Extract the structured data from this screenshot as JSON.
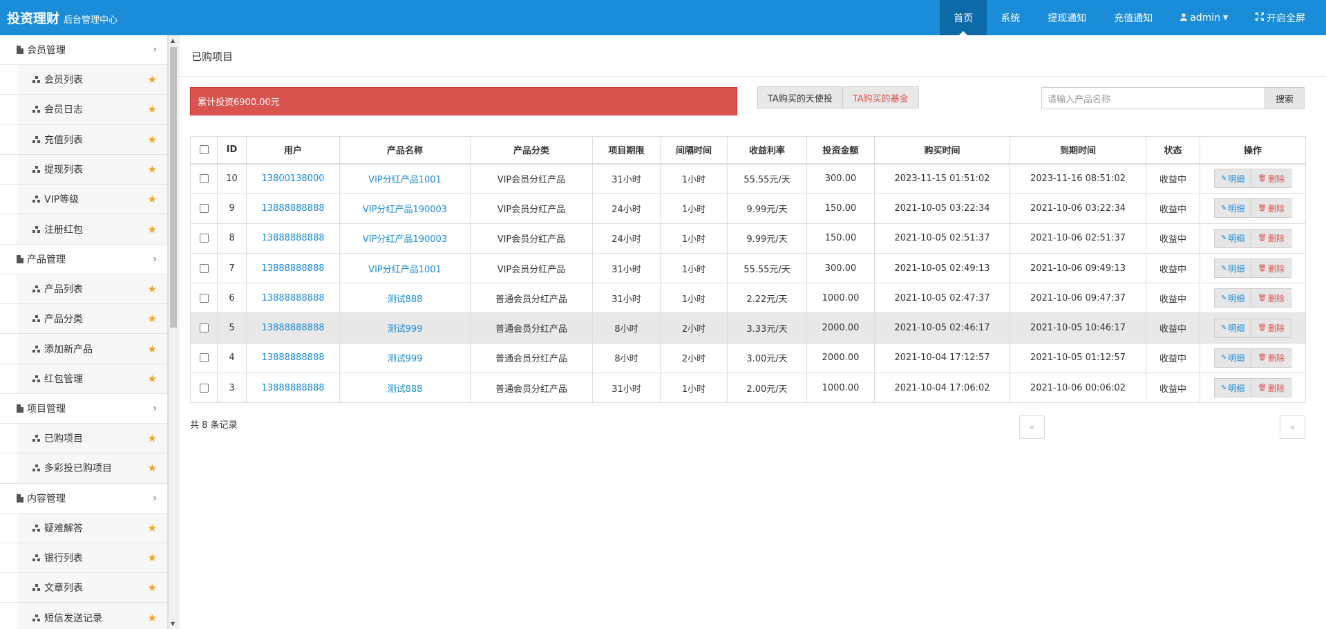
{
  "brand": {
    "title": "投资理财",
    "subtitle": "后台管理中心"
  },
  "topnav": [
    {
      "label": "首页",
      "active": true
    },
    {
      "label": "系统"
    },
    {
      "label": "提现通知"
    },
    {
      "label": "充值通知"
    },
    {
      "label": "admin",
      "icon": "user-icon",
      "dropdown": true
    },
    {
      "label": "开启全屏",
      "icon": "fullscreen-icon"
    }
  ],
  "sidebar": {
    "groups": [
      {
        "label": "会员管理",
        "items": [
          "会员列表",
          "会员日志",
          "充值列表",
          "提现列表",
          "VIP等级",
          "注册红包"
        ]
      },
      {
        "label": "产品管理",
        "items": [
          "产品列表",
          "产品分类",
          "添加新产品",
          "红包管理"
        ]
      },
      {
        "label": "项目管理",
        "items": [
          "已购项目",
          "多彩投已购项目"
        ]
      },
      {
        "label": "内容管理",
        "items": [
          "疑难解答",
          "银行列表",
          "文章列表",
          "短信发送记录"
        ]
      }
    ]
  },
  "page": {
    "title": "已购项目",
    "total_invest": "累计投资6900.00元",
    "tab_angel": "TA购买的天使投",
    "tab_fund": "TA购买的基金",
    "search_placeholder": "请输入产品名称",
    "search_button": "搜索",
    "record_count": "共 8 条记录",
    "pager_prev": "«",
    "pager_next": "»"
  },
  "table": {
    "headers": [
      "ID",
      "用户",
      "产品名称",
      "产品分类",
      "项目期限",
      "间隔时间",
      "收益利率",
      "投资金额",
      "购买时间",
      "到期时间",
      "状态",
      "操作"
    ],
    "detail_label": "明细",
    "delete_label": "删除",
    "rows": [
      {
        "id": "10",
        "user": "13800138000",
        "product": "VIP分红产品1001",
        "category": "VIP会员分红产品",
        "term": "31小时",
        "interval": "1小时",
        "rate": "55.55元/天",
        "amount": "300.00",
        "buy": "2023-11-15 01:51:02",
        "expire": "2023-11-16 08:51:02",
        "status": "收益中"
      },
      {
        "id": "9",
        "user": "13888888888",
        "product": "VIP分红产品190003",
        "category": "VIP会员分红产品",
        "term": "24小时",
        "interval": "1小时",
        "rate": "9.99元/天",
        "amount": "150.00",
        "buy": "2021-10-05 03:22:34",
        "expire": "2021-10-06 03:22:34",
        "status": "收益中"
      },
      {
        "id": "8",
        "user": "13888888888",
        "product": "VIP分红产品190003",
        "category": "VIP会员分红产品",
        "term": "24小时",
        "interval": "1小时",
        "rate": "9.99元/天",
        "amount": "150.00",
        "buy": "2021-10-05 02:51:37",
        "expire": "2021-10-06 02:51:37",
        "status": "收益中"
      },
      {
        "id": "7",
        "user": "13888888888",
        "product": "VIP分红产品1001",
        "category": "VIP会员分红产品",
        "term": "31小时",
        "interval": "1小时",
        "rate": "55.55元/天",
        "amount": "300.00",
        "buy": "2021-10-05 02:49:13",
        "expire": "2021-10-06 09:49:13",
        "status": "收益中"
      },
      {
        "id": "6",
        "user": "13888888888",
        "product": "测试888",
        "category": "普通会员分红产品",
        "term": "31小时",
        "interval": "1小时",
        "rate": "2.22元/天",
        "amount": "1000.00",
        "buy": "2021-10-05 02:47:37",
        "expire": "2021-10-06 09:47:37",
        "status": "收益中"
      },
      {
        "id": "5",
        "user": "13888888888",
        "product": "测试999",
        "category": "普通会员分红产品",
        "term": "8小时",
        "interval": "2小时",
        "rate": "3.33元/天",
        "amount": "2000.00",
        "buy": "2021-10-05 02:46:17",
        "expire": "2021-10-05 10:46:17",
        "status": "收益中",
        "highlight": true
      },
      {
        "id": "4",
        "user": "13888888888",
        "product": "测试999",
        "category": "普通会员分红产品",
        "term": "8小时",
        "interval": "2小时",
        "rate": "3.00元/天",
        "amount": "2000.00",
        "buy": "2021-10-04 17:12:57",
        "expire": "2021-10-05 01:12:57",
        "status": "收益中"
      },
      {
        "id": "3",
        "user": "13888888888",
        "product": "测试888",
        "category": "普通会员分红产品",
        "term": "31小时",
        "interval": "1小时",
        "rate": "2.00元/天",
        "amount": "1000.00",
        "buy": "2021-10-04 17:06:02",
        "expire": "2021-10-06 00:06:02",
        "status": "收益中"
      }
    ]
  },
  "colors": {
    "primary": "#1a8cd8",
    "danger": "#d9534f",
    "star": "#f7a21b"
  }
}
